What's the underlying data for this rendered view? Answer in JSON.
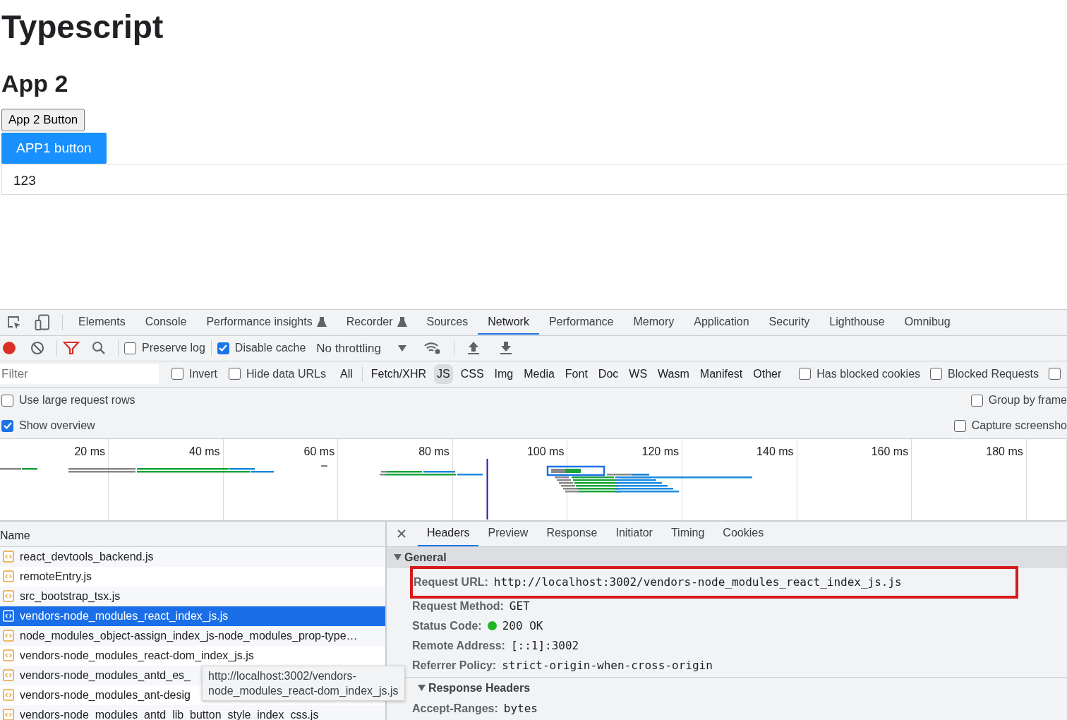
{
  "page": {
    "title": "Typescript",
    "heading": "App 2",
    "buttons": [
      {
        "label": "App 2 Button",
        "kind": "default"
      },
      {
        "label": "APP1 button",
        "kind": "primary"
      }
    ],
    "output": "123"
  },
  "devtools": {
    "tabs": [
      {
        "label": "Elements",
        "experimental": false,
        "selected": false
      },
      {
        "label": "Console",
        "experimental": false,
        "selected": false
      },
      {
        "label": "Performance insights",
        "experimental": true,
        "selected": false
      },
      {
        "label": "Recorder",
        "experimental": true,
        "selected": false
      },
      {
        "label": "Sources",
        "experimental": false,
        "selected": false
      },
      {
        "label": "Network",
        "experimental": false,
        "selected": true
      },
      {
        "label": "Performance",
        "experimental": false,
        "selected": false
      },
      {
        "label": "Memory",
        "experimental": false,
        "selected": false
      },
      {
        "label": "Application",
        "experimental": false,
        "selected": false
      },
      {
        "label": "Security",
        "experimental": false,
        "selected": false
      },
      {
        "label": "Lighthouse",
        "experimental": false,
        "selected": false
      },
      {
        "label": "Omnibug",
        "experimental": false,
        "selected": false
      }
    ],
    "toolbar": {
      "recording": true,
      "preserve_log": {
        "label": "Preserve log",
        "checked": false
      },
      "disable_cache": {
        "label": "Disable cache",
        "checked": true
      },
      "throttling": "No throttling"
    },
    "filter": {
      "placeholder": "Filter",
      "checks": [
        {
          "label": "Invert",
          "checked": false
        },
        {
          "label": "Hide data URLs",
          "checked": false
        }
      ],
      "types": [
        {
          "label": "All",
          "selected": false
        },
        {
          "label": "Fetch/XHR",
          "selected": false
        },
        {
          "label": "JS",
          "selected": true
        },
        {
          "label": "CSS",
          "selected": false
        },
        {
          "label": "Img",
          "selected": false
        },
        {
          "label": "Media",
          "selected": false
        },
        {
          "label": "Font",
          "selected": false
        },
        {
          "label": "Doc",
          "selected": false
        },
        {
          "label": "WS",
          "selected": false
        },
        {
          "label": "Wasm",
          "selected": false
        },
        {
          "label": "Manifest",
          "selected": false
        },
        {
          "label": "Other",
          "selected": false
        }
      ],
      "extra_checks": [
        {
          "label": "Has blocked cookies",
          "checked": false
        },
        {
          "label": "Blocked Requests",
          "checked": false
        }
      ],
      "edge_check": {
        "checked": false
      }
    },
    "options_left": [
      {
        "label": "Use large request rows",
        "checked": false
      },
      {
        "label": "Show overview",
        "checked": true
      }
    ],
    "options_right": [
      {
        "label": "Group by frame",
        "checked": false
      },
      {
        "label": "Capture screensho",
        "checked": false
      }
    ],
    "overview_ticks": [
      "20 ms",
      "40 ms",
      "60 ms",
      "80 ms",
      "100 ms",
      "120 ms",
      "140 ms",
      "160 ms",
      "180 ms"
    ],
    "requests": {
      "column": "Name",
      "rows": [
        {
          "name": "react_devtools_backend.js",
          "selected": false
        },
        {
          "name": "remoteEntry.js",
          "selected": false
        },
        {
          "name": "src_bootstrap_tsx.js",
          "selected": false
        },
        {
          "name": "vendors-node_modules_react_index_js.js",
          "selected": true
        },
        {
          "name": "node_modules_object-assign_index_js-node_modules_prop-type…",
          "selected": false
        },
        {
          "name": "vendors-node_modules_react-dom_index_js.js",
          "selected": false
        },
        {
          "name": "vendors-node_modules_antd_es_",
          "selected": false
        },
        {
          "name": "vendors-node_modules_ant-desig",
          "selected": false
        },
        {
          "name": "vendors-node_modules_antd_lib_button_style_index_css.js",
          "selected": false
        }
      ],
      "tooltip": [
        "http://localhost:3002/vendors-",
        "node_modules_react-dom_index_js.js"
      ]
    },
    "detail": {
      "tabs": [
        {
          "label": "Headers",
          "selected": true
        },
        {
          "label": "Preview",
          "selected": false
        },
        {
          "label": "Response",
          "selected": false
        },
        {
          "label": "Initiator",
          "selected": false
        },
        {
          "label": "Timing",
          "selected": false
        },
        {
          "label": "Cookies",
          "selected": false
        }
      ],
      "sections": [
        {
          "title": "General",
          "expanded": true,
          "fields": [
            {
              "label": "Request URL:",
              "value": "http://localhost:3002/vendors-node_modules_react_index_js.js",
              "highlighted": true
            },
            {
              "label": "Request Method:",
              "value": "GET",
              "highlighted": false
            },
            {
              "label": "Status Code:",
              "value": "200  OK",
              "highlighted": false,
              "color": "#22b422"
            },
            {
              "label": "Remote Address:",
              "value": "[::1]:3002",
              "highlighted": false
            },
            {
              "label": "Referrer Policy:",
              "value": "strict-origin-when-cross-origin",
              "highlighted": false
            }
          ]
        },
        {
          "title": "Response Headers",
          "expanded": true,
          "fields": [
            {
              "label": "Accept-Ranges:",
              "value": "bytes",
              "highlighted": false
            }
          ]
        }
      ]
    }
  }
}
